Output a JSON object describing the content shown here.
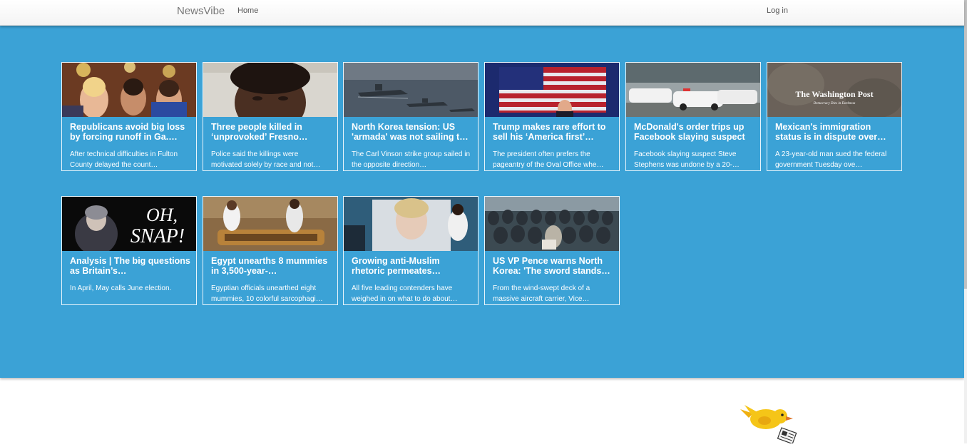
{
  "nav": {
    "brand": "NewsVibe",
    "home": "Home",
    "login": "Log in"
  },
  "colors": {
    "hero_background": "#3ba2d6",
    "card_border": "#e8f4fb",
    "mascot": "#f5c518"
  },
  "articles": [
    {
      "title": "Republicans avoid big loss by forcing runoff in Ga.…",
      "description": "After technical difficulties in Fulton County delayed the count…",
      "image": "crowd-celebrating-photo"
    },
    {
      "title": "Three people killed in ‘unprovoked’ Fresno…",
      "description": "Police said the killings were motivated solely by race and not…",
      "image": "suspect-portrait-photo"
    },
    {
      "title": "North Korea tension: US 'armada' was not sailing t…",
      "description": "The Carl Vinson strike group sailed in the opposite direction…",
      "image": "warships-at-sea-photo"
    },
    {
      "title": "Trump makes rare effort to sell his ‘America first’…",
      "description": "The president often prefers the pageantry of the Oval Office whe…",
      "image": "american-flag-photo"
    },
    {
      "title": "McDonald's order trips up Facebook slaying suspect",
      "description": "Facebook slaying suspect Steve Stephens was undone by a 20-…",
      "image": "police-cars-photo"
    },
    {
      "title": "Mexican's immigration status is in dispute over…",
      "description": "A 23-year-old man sued the federal government Tuesday ove…",
      "image": "washington-post-logo",
      "logo_text": "The Washington Post",
      "logo_tagline": "Democracy Dies in Darkness"
    },
    {
      "title": "Analysis | The big questions as Britain’s…",
      "description": "In April, May calls June election.",
      "image": "oh-snap-photo",
      "overlay_text": "OH, SNAP!"
    },
    {
      "title": "Egypt unearths 8 mummies in 3,500-year-…",
      "description": "Egyptian officials unearthed eight mummies, 10 colorful sarcophagi…",
      "image": "archaeologists-tomb-photo"
    },
    {
      "title": "Growing anti-Muslim rhetoric permeates…",
      "description": "All five leading contenders have weighed in on what to do about…",
      "image": "campaign-poster-photo"
    },
    {
      "title": "US VP Pence warns North Korea: 'The sword stands…",
      "description": "From the wind-swept deck of a massive aircraft carrier, Vice…",
      "image": "sailors-on-deck-photo"
    }
  ]
}
